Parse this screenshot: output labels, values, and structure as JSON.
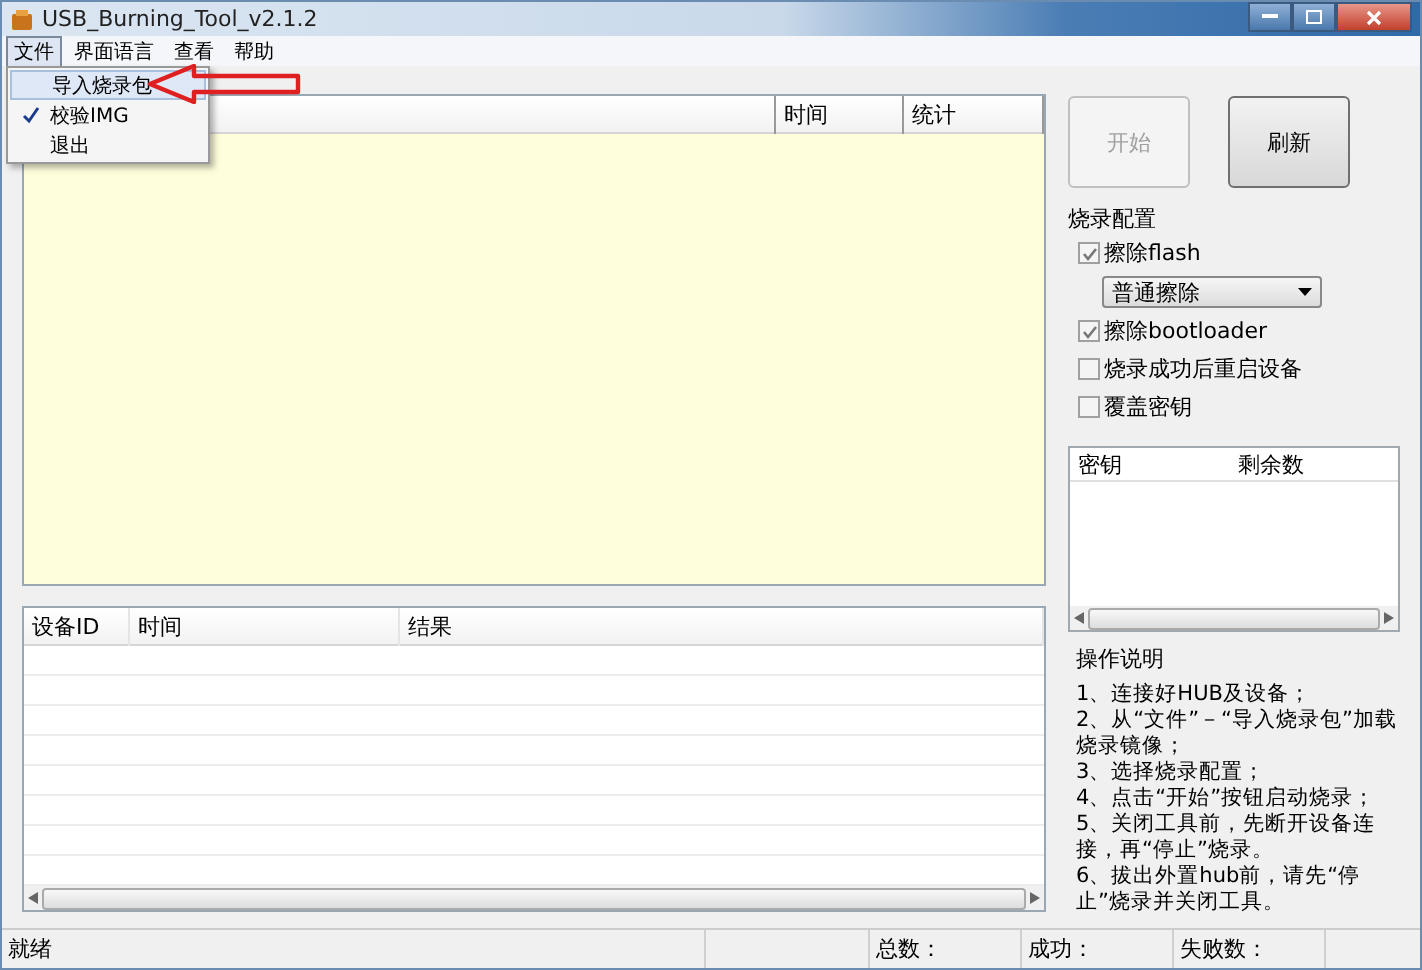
{
  "window": {
    "title": "USB_Burning_Tool_v2.1.2"
  },
  "menu": [
    {
      "label": "文件",
      "selected": true
    },
    {
      "label": "界面语言",
      "selected": false
    },
    {
      "label": "查看",
      "selected": false
    },
    {
      "label": "帮助",
      "selected": false
    }
  ],
  "file_menu": [
    {
      "label": "导入烧录包",
      "checked": false,
      "selected": true
    },
    {
      "label": "校验IMG",
      "checked": true,
      "selected": false
    },
    {
      "label": "退出",
      "checked": false,
      "selected": false
    }
  ],
  "device_table": {
    "columns": [
      "",
      "时间",
      "统计"
    ]
  },
  "buttons": [
    {
      "label": "开始",
      "disabled": true
    },
    {
      "label": "刷新",
      "disabled": false
    }
  ],
  "config": {
    "title": "烧录配置",
    "options": [
      {
        "kind": "checkbox",
        "label": "擦除flash",
        "checked": true
      },
      {
        "kind": "dropdown",
        "value": "普通擦除"
      },
      {
        "kind": "checkbox",
        "label": "擦除bootloader",
        "checked": true
      },
      {
        "kind": "checkbox",
        "label": "烧录成功后重启设备",
        "checked": false
      },
      {
        "kind": "checkbox",
        "label": "覆盖密钥",
        "checked": false
      }
    ]
  },
  "key_table": {
    "columns": [
      "密钥",
      "剩余数"
    ]
  },
  "result_table": {
    "columns": [
      "设备ID",
      "时间",
      "结果"
    ]
  },
  "instructions": {
    "title": "操作说明",
    "steps": [
      "1、连接好HUB及设备；",
      "2、从“文件”－“导入烧录包”加载烧录镜像；",
      "3、选择烧录配置；",
      "4、点击“开始”按钮启动烧录；",
      "5、关闭工具前，先断开设备连接，再“停止”烧录。",
      "6、拔出外置hub前，请先“停止”烧录并关闭工具。"
    ]
  },
  "status_bar": {
    "status": "就绪",
    "fields": [
      "总数：",
      "成功：",
      "失败数："
    ]
  }
}
